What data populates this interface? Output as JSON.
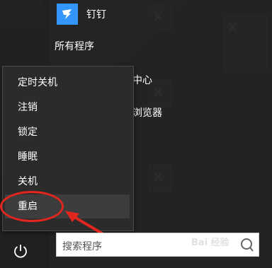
{
  "start_menu": {
    "pinned_app": {
      "label": "钉钉",
      "icon": "dingtalk-icon"
    },
    "all_programs_label": "所有程序",
    "background_items": {
      "center_partial": "中心",
      "browser_partial": "浏览器"
    }
  },
  "power_menu": {
    "items": [
      {
        "label": "定时关机"
      },
      {
        "label": "注销"
      },
      {
        "label": "锁定"
      },
      {
        "label": "睡眠"
      },
      {
        "label": "关机"
      },
      {
        "label": "重启"
      }
    ],
    "highlighted_item": "重启"
  },
  "search": {
    "placeholder": "搜索程序"
  },
  "power_button_icon": "power-icon",
  "watermark": "Bai 经验",
  "colors": {
    "annotation_red": "#e0261e",
    "dingtalk_blue": "#3296fa"
  }
}
